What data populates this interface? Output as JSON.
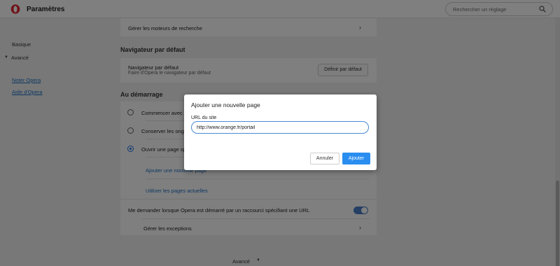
{
  "header": {
    "title": "Paramètres",
    "logo_icon": "opera-logo-icon",
    "search_placeholder": "Rechercher un réglage",
    "search_icon": "search-icon"
  },
  "sidebar": {
    "basic_label": "Basique",
    "advanced_label": "Avancé",
    "advanced_arrow": "▼",
    "links": [
      "Noter Opera",
      "Aide d'Opera"
    ]
  },
  "main": {
    "search_engines_row": "Gérer les moteurs de recherche",
    "default_browser": {
      "section_title": "Navigateur par défaut",
      "row_title": "Navigateur par défaut",
      "row_subtitle": "Faire d'Opera le navigateur par défaut",
      "button_label": "Définir par défaut"
    },
    "startup": {
      "section_title": "Au démarrage",
      "options": [
        "Commencer avec la page d'accueil",
        "Conserver les onglets de la session précédente",
        "Ouvrir une page spécifique ou un ensemble de pages"
      ],
      "selected_index": 2,
      "add_page_link": "Ajouter une nouvelle page",
      "use_current_link": "Utiliser les pages actuelles",
      "ask_shortcut_label": "Me demander lorsque Opera est démarré par un raccourci spécifiant une URL",
      "ask_shortcut_enabled": true,
      "exceptions_row": "Gérer les exceptions"
    },
    "footer_advanced": "Avancé",
    "footer_arrow": "▼",
    "chevron": "›"
  },
  "dialog": {
    "title": "Ajouter une nouvelle page",
    "field_label": "URL du site",
    "field_value": "http://www.orange.fr/portail",
    "cancel_label": "Annuler",
    "add_label": "Ajouter"
  },
  "colors": {
    "accent": "#2a8ef0",
    "link": "#1a6fc4",
    "brand_red": "#e0202c"
  }
}
